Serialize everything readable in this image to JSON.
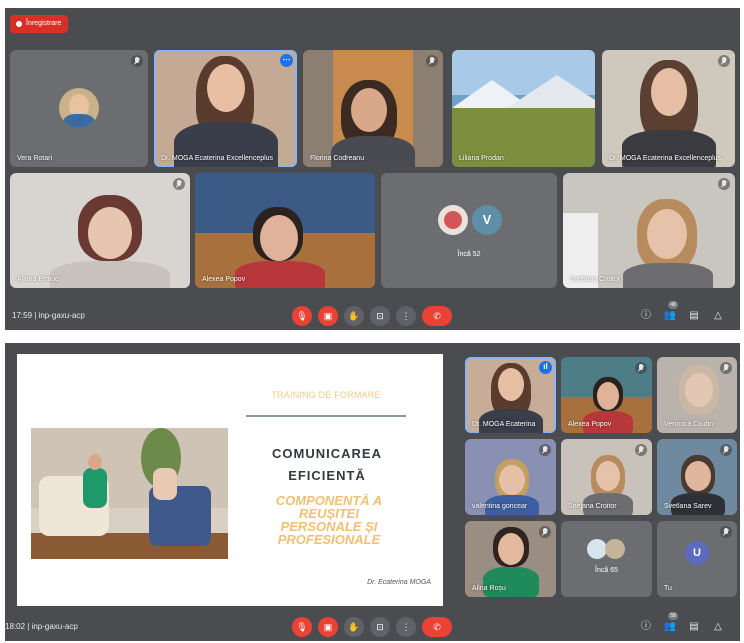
{
  "screen1": {
    "record_label": "Înregistrare",
    "clock": "17:59",
    "meeting_code": "inp-gaxu-acp",
    "participants_badge": "48",
    "others_label": "Încă 52",
    "others_avatar_letter": "V",
    "tiles": [
      {
        "name": "Vera Rotari"
      },
      {
        "name": "Dr. MOGA Ecaterina Excellenceplus"
      },
      {
        "name": "Florina Codreanu"
      },
      {
        "name": "Liliana Prodan"
      },
      {
        "name": "Dr. MOGA Ecaterina Excellenceplus"
      },
      {
        "name": "Aliona Ermuc"
      },
      {
        "name": "Alexea Popov"
      },
      {
        "name": "Svetlana Croitor"
      }
    ]
  },
  "screen2": {
    "clock": "18:02",
    "meeting_code": "inp-gaxu-acp",
    "participants_badge": "58",
    "others_label": "Încă 65",
    "you_label": "Tu",
    "you_avatar_letter": "U",
    "tiles": [
      {
        "name": "Dr. MOGA Ecaterina"
      },
      {
        "name": "Alexea Popov"
      },
      {
        "name": "Veronica Ciudin"
      },
      {
        "name": "valentina goncear"
      },
      {
        "name": "Snejana Croitor"
      },
      {
        "name": "Svetlana Sarev"
      },
      {
        "name": "Alina Roșu"
      }
    ],
    "slide": {
      "training": "TRAINING DE FORMARE",
      "title_line1": "COMUNICAREA",
      "title_line2": "EFICIENTĂ",
      "subtitle_lines": [
        "COMPONENTĂ A",
        "REUȘITEI",
        "PERSONALE ȘI",
        "PROFESIONALE"
      ],
      "author": "Dr. Ecaterina MOGA"
    }
  },
  "icons": [
    "mic-off-icon",
    "camera-off-icon",
    "raise-hand-icon",
    "present-icon",
    "more-options-icon",
    "end-call-icon",
    "info-icon",
    "people-icon",
    "chat-icon",
    "activities-icon"
  ]
}
